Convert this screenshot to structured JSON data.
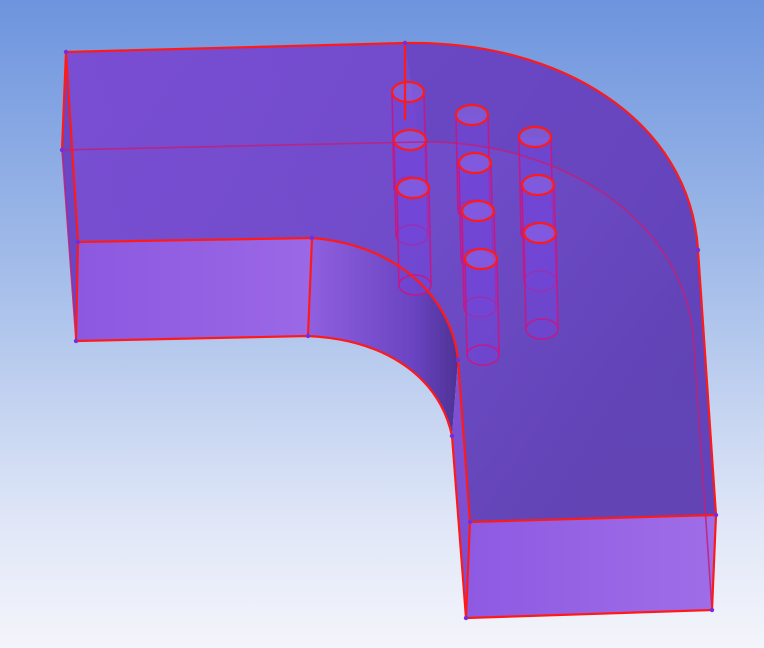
{
  "viewport": {
    "background_top": "#6d94de",
    "background_bottom": "#f4f5fb"
  },
  "model": {
    "name": "elbow-duct-with-tube-bank",
    "face_color": "#7b4fd4",
    "face_color_light": "#9a6ae6",
    "face_color_dark": "#5c3cae",
    "edge_color": "#ff1a1a",
    "vertex_color": "#7a2bd9",
    "tube_rows": 3,
    "tube_count": 9
  }
}
